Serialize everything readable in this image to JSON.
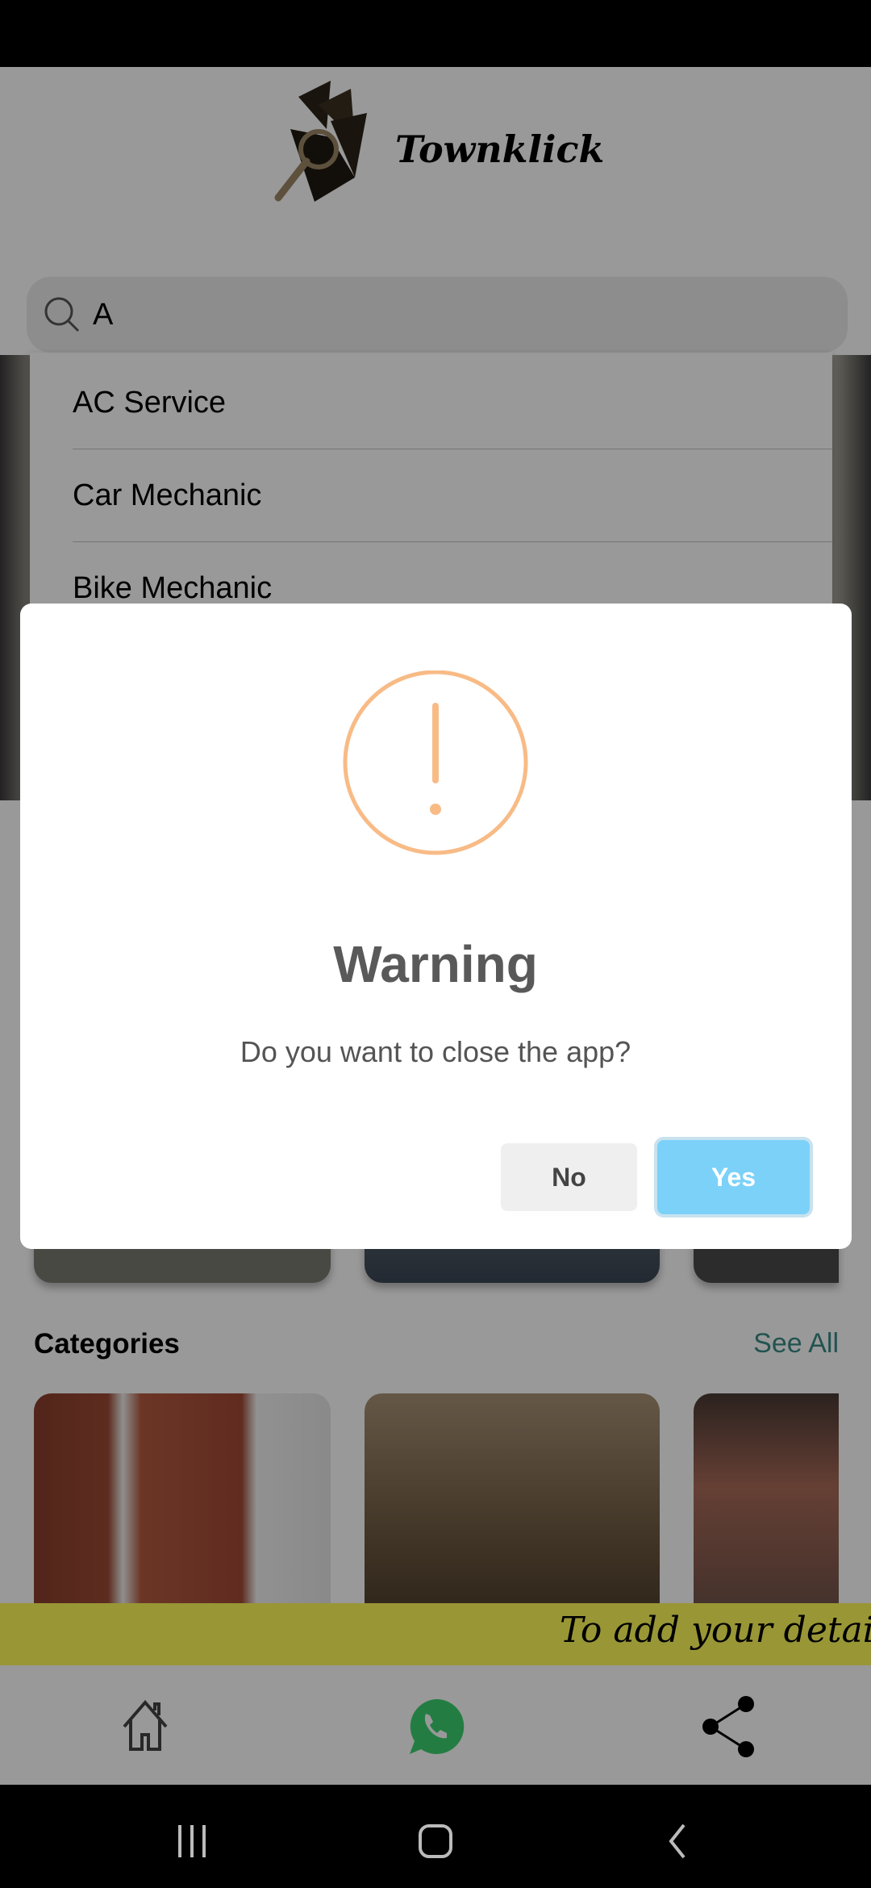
{
  "app": {
    "name": "Townklick"
  },
  "search": {
    "value": "A"
  },
  "suggestions": [
    "AC Service",
    "Car Mechanic",
    "Bike Mechanic"
  ],
  "categories": {
    "title": "Categories",
    "see_all": "See All"
  },
  "banner": {
    "text": "To add your details, co"
  },
  "dialog": {
    "title": "Warning",
    "message": "Do you want to close the app?",
    "no_label": "No",
    "yes_label": "Yes",
    "icon": "warning-exclamation",
    "icon_color": "#f8bb86",
    "confirm_color": "#7cd1f9"
  },
  "bottom_nav": {
    "items": [
      "home-icon",
      "whatsapp-icon",
      "share-icon"
    ]
  },
  "system_nav": [
    "recents",
    "home",
    "back"
  ]
}
